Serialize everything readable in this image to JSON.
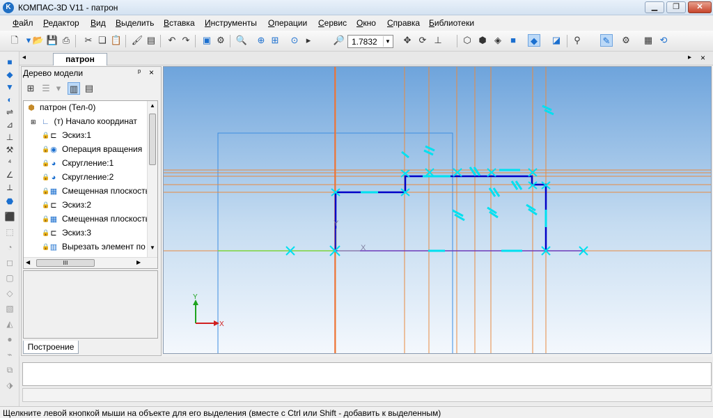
{
  "app": {
    "title": "КОМПАС-3D V11 - патрон",
    "icon_letter": "K"
  },
  "window_buttons": {
    "minimize": "▁",
    "restore": "❐",
    "close": "✕"
  },
  "menu": [
    {
      "label_u": "Ф",
      "label_rest": "айл"
    },
    {
      "label_u": "Р",
      "label_rest": "едактор"
    },
    {
      "label_u": "В",
      "label_rest": "ид"
    },
    {
      "label_u": "В",
      "label_rest": "ыделить"
    },
    {
      "label_u": "В",
      "label_rest": "ставка"
    },
    {
      "label_u": "И",
      "label_rest": "нструменты"
    },
    {
      "label_u": "О",
      "label_rest": "перации"
    },
    {
      "label_u": "С",
      "label_rest": "ервис"
    },
    {
      "label_u": "О",
      "label_rest": "кно"
    },
    {
      "label_u": "С",
      "label_rest": "правка"
    },
    {
      "label_u": "Б",
      "label_rest": "иблиотеки"
    }
  ],
  "toolbar": {
    "zoom_value": "1.7832",
    "icons": [
      "new-icon",
      "open-icon",
      "save-icon",
      "print-icon",
      "cut-icon",
      "copy-icon",
      "paste-icon",
      "properties-brush-icon",
      "library-icon",
      "undo-icon",
      "redo-icon",
      "manager-icon",
      "variables-icon",
      "magnify-icon",
      "zoom-window-icon",
      "zoom-in-icon",
      "zoom-scale-icon",
      "pan-icon",
      "rotate-icon",
      "orientation-icon",
      "wireframe-icon",
      "hidden-lines-icon",
      "no-hidden-icon",
      "shaded-icon",
      "shaded-edges-icon",
      "perspective-icon",
      "filter-icon",
      "sketch-mode-icon",
      "view-tools-icon",
      "regenerate-icon"
    ]
  },
  "document": {
    "tab_label": "патрон"
  },
  "tree": {
    "header": "Дерево модели",
    "pin_glyph": "ᵖ",
    "close_glyph": "×",
    "nodes": [
      {
        "label": "патрон (Тел-0)",
        "icon": "part-icon",
        "kind": "root"
      },
      {
        "label": "(т) Начало координат",
        "icon": "origin-icon",
        "kind": "expand"
      },
      {
        "label": "Эскиз:1",
        "icon": "sketch-icon",
        "kind": "locked"
      },
      {
        "label": "Операция вращения",
        "icon": "rotation-icon",
        "kind": "locked"
      },
      {
        "label": "Скругление:1",
        "icon": "fillet-icon",
        "kind": "locked"
      },
      {
        "label": "Скругление:2",
        "icon": "fillet-icon",
        "kind": "locked"
      },
      {
        "label": "Смещенная плоскость",
        "icon": "plane-icon",
        "kind": "locked"
      },
      {
        "label": "Эскиз:2",
        "icon": "sketch-icon",
        "kind": "locked"
      },
      {
        "label": "Смещенная плоскость",
        "icon": "plane-icon",
        "kind": "locked"
      },
      {
        "label": "Эскиз:3",
        "icon": "sketch-icon",
        "kind": "locked"
      },
      {
        "label": "Вырезать элемент по",
        "icon": "cut-extrude-icon",
        "kind": "locked"
      }
    ],
    "hscroll_mark": "III",
    "bottom_tab": "Построение"
  },
  "canvas": {
    "axis_y_label": "Y",
    "axis_x_label": "X",
    "sketch_x_label": "X",
    "sketch_y_label": "Y",
    "colors": {
      "sketch": "#0000c8",
      "constraint": "#00e0f0",
      "guide": "#e88a40",
      "plane": "#3d8de0"
    }
  },
  "status": {
    "text": "Щелкните левой кнопкой мыши на объекте для его выделения (вместе с Ctrl или Shift - добавить к выделенным)"
  }
}
